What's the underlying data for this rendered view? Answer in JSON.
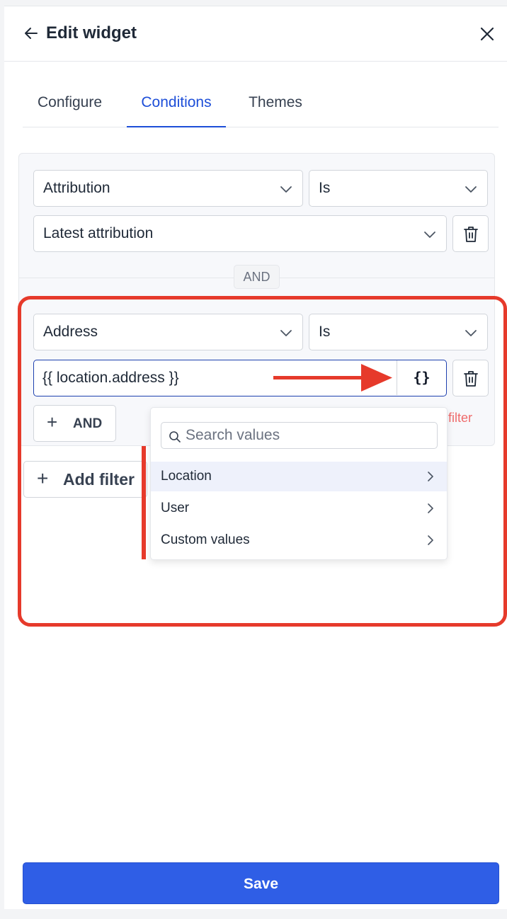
{
  "header": {
    "title": "Edit widget"
  },
  "tabs": [
    {
      "label": "Configure"
    },
    {
      "label": "Conditions"
    },
    {
      "label": "Themes"
    }
  ],
  "filters": [
    {
      "field": "Attribution",
      "operator": "Is",
      "value": "Latest attribution"
    },
    {
      "field": "Address",
      "operator": "Is",
      "value": "{{ location.address }}",
      "value_button": "{}"
    }
  ],
  "and_separator": "AND",
  "and_button": {
    "icon": "+",
    "label": "AND"
  },
  "remove_filter_label": "e filter",
  "add_filter": {
    "icon": "+",
    "label": "Add filter"
  },
  "value_menu": {
    "search_placeholder": "Search values",
    "items": [
      {
        "label": "Location",
        "highlighted": true
      },
      {
        "label": "User"
      },
      {
        "label": "Custom values"
      }
    ]
  },
  "save_label": "Save",
  "colors": {
    "accent": "#1d4ed8",
    "save": "#2f5ee6",
    "annotation": "#e63a2b",
    "danger": "#ef6b6b"
  }
}
